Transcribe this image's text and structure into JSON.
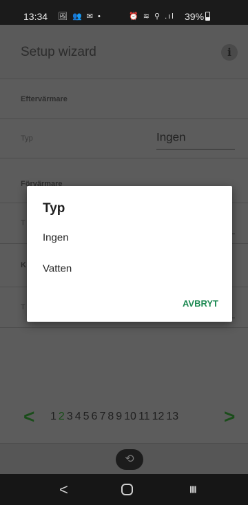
{
  "status_bar": {
    "time": "13:34",
    "left_icons": "🖼 👥 ✉ •",
    "right_icons": "⏰ ≋ ⚲ .ıl",
    "battery": "39%"
  },
  "app_bar": {
    "title": "Setup wizard",
    "info_icon": "i"
  },
  "sections": {
    "eftervarmare": {
      "header": "Eftervärmare",
      "type_label": "Typ",
      "type_value": "Ingen"
    },
    "forvarmare": {
      "header": "Förvärmare",
      "type_label": "T"
    },
    "third": {
      "header": "K",
      "type_label": "T"
    }
  },
  "pager": {
    "prev_arrow": "<",
    "next_arrow": ">",
    "pages": [
      "1",
      "2",
      "3",
      "4",
      "5",
      "6",
      "7",
      "8",
      "9",
      "10",
      "11",
      "12",
      "13"
    ],
    "current_page": "2"
  },
  "bottom": {
    "back_icon": "⟲"
  },
  "nav_bar": {
    "back": "<",
    "recent": "III"
  },
  "dialog": {
    "title": "Typ",
    "options": [
      "Ingen",
      "Vatten"
    ],
    "cancel_label": "AVBRYT"
  },
  "colors": {
    "accent": "#1e8a53",
    "pager_current": "#174d17",
    "scrim_background": "#5c5c5c"
  }
}
